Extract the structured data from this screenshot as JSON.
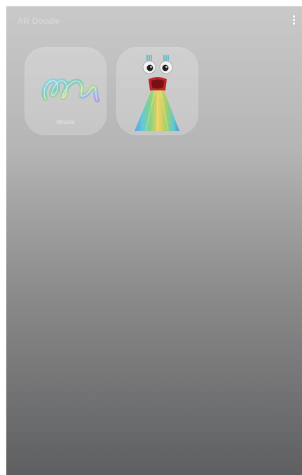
{
  "screen": {
    "title": "AR Doodle"
  },
  "stickers": [
    {
      "label": "Miracle",
      "icon": "ribbon-doodle-icon"
    },
    {
      "label": "",
      "icon": "rainbow-mouth-monster-icon"
    }
  ],
  "menu": {
    "icon": "more-options-icon"
  }
}
